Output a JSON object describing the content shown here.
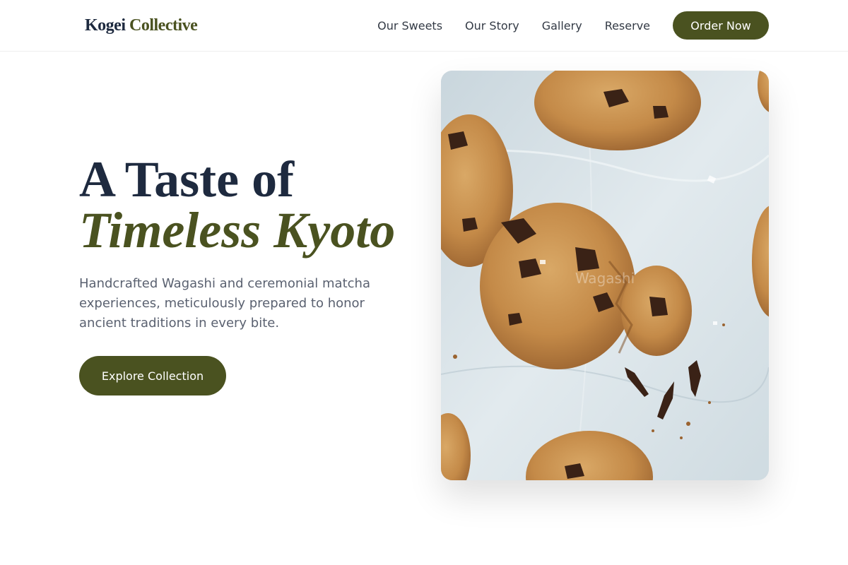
{
  "brand": {
    "name_part1": "Kogei",
    "name_part2": "Collective"
  },
  "nav": {
    "links": [
      "Our Sweets",
      "Our Story",
      "Gallery",
      "Reserve"
    ],
    "cta_label": "Order Now"
  },
  "hero": {
    "title_line1": "A Taste of",
    "title_line2": "Timeless Kyoto",
    "description": "Handcrafted Wagashi and ceremonial matcha experiences, meticulously prepared to honor ancient traditions in every bite.",
    "cta_label": "Explore Collection",
    "image": {
      "alt": "Chocolate chip cookies on parchment paper",
      "watermark": "Wagashi"
    }
  },
  "colors": {
    "brand_green": "#4a5220",
    "navy": "#1e2a3f",
    "body_text": "#5a6170"
  }
}
